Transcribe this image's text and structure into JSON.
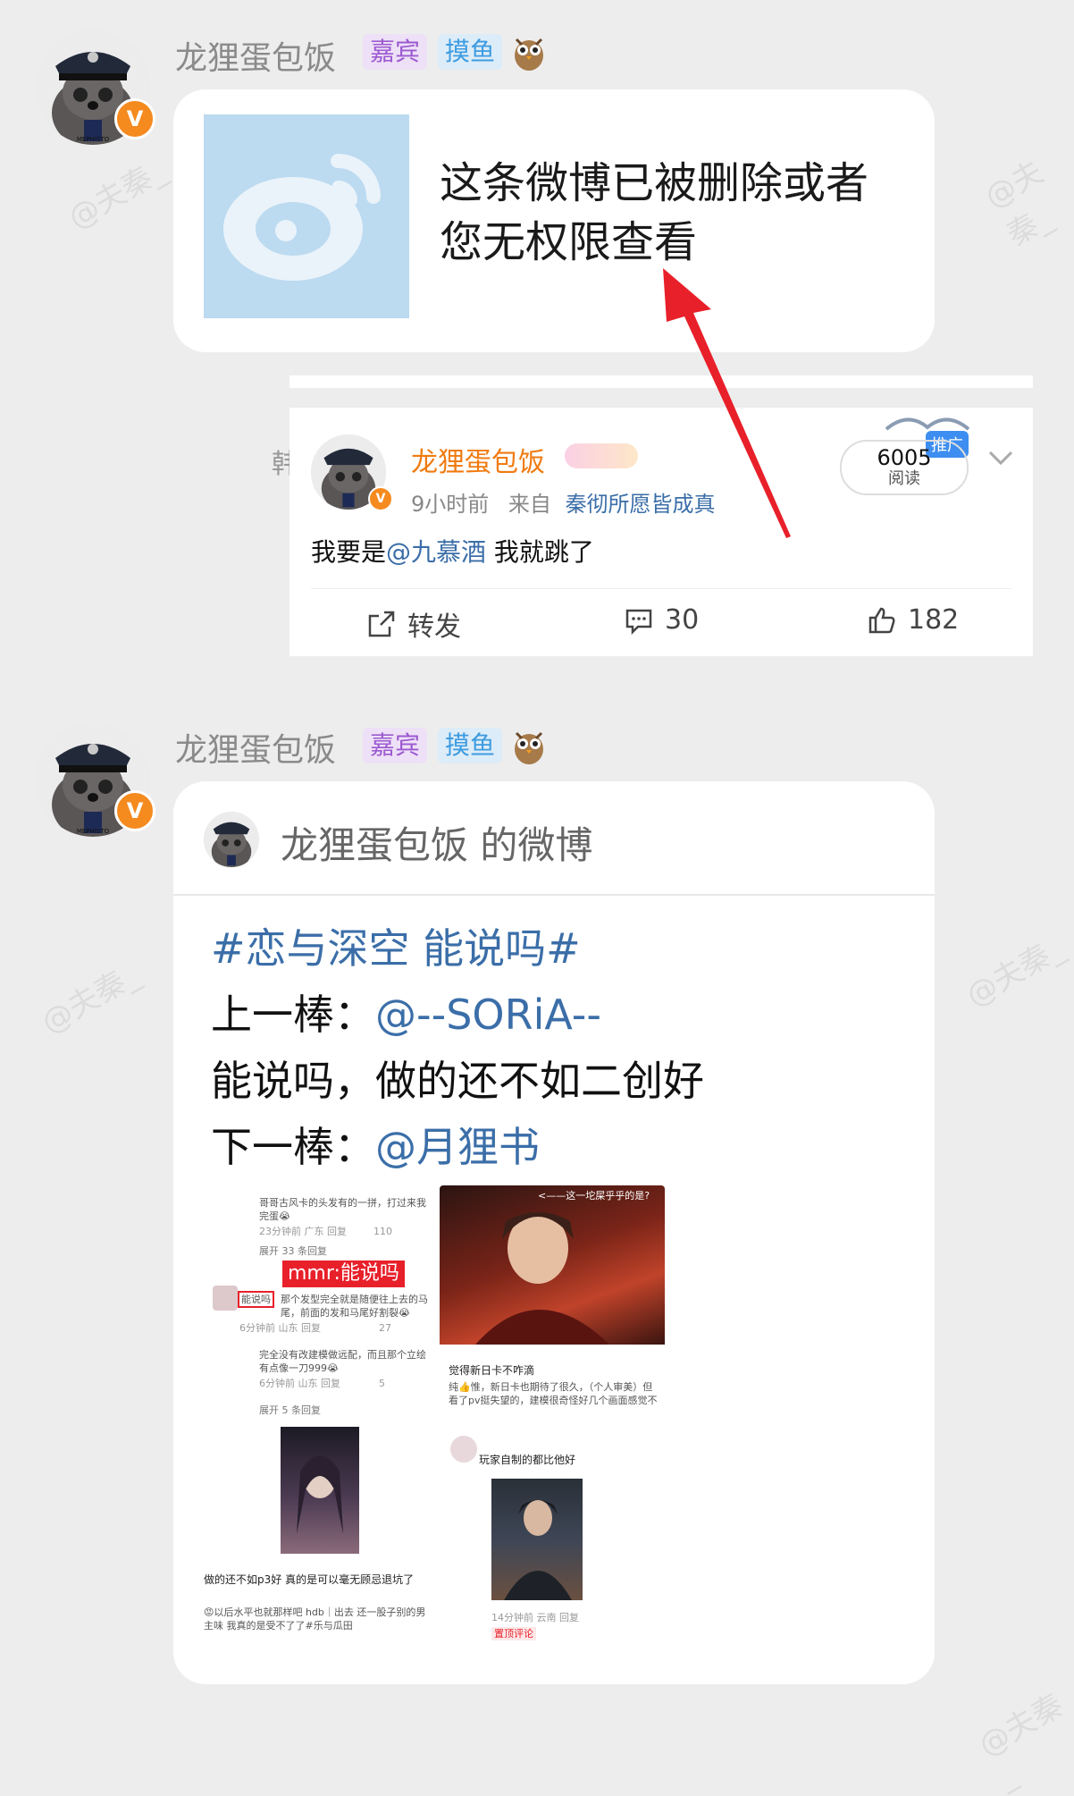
{
  "watermarks": [
    "@夫秦_",
    "@夫秦_",
    "@夫秦_",
    "@夫秦_",
    "@夫秦_"
  ],
  "msg1": {
    "username": "龙狸蛋包饭",
    "tag_guest": "嘉宾",
    "tag_fish": "摸鱼",
    "deleted_text_line1": "这条微博已被删除或者",
    "deleted_text_line2": "您无权限查看"
  },
  "embedded_post": {
    "side_char": "韩",
    "author": "龙狸蛋包饭",
    "time": "9小时前",
    "from_label": "来自",
    "source": "秦彻所愿皆成真",
    "promo_label": "推广",
    "reads_count": "6005",
    "reads_label": "阅读",
    "body_prefix": "我要是",
    "mention": "@九慕酒",
    "body_suffix": " 我就跳了",
    "repost_label": "转发",
    "comment_count": "30",
    "like_count": "182"
  },
  "msg2": {
    "username": "龙狸蛋包饭",
    "tag_guest": "嘉宾",
    "tag_fish": "摸鱼",
    "card_title": "龙狸蛋包饭 的微博",
    "hashtag": "#恋与深空 能说吗#",
    "line2_prefix": "上一棒：",
    "line2_mention": "@--SORiA--",
    "line3": "能说吗，做的还不如二创好",
    "line4_prefix": "下一棒：",
    "line4_mention": "@月狸书"
  },
  "collage": {
    "tl_comment1": "哥哥古风卡的头发有的一拼，打过来我完蛋😭",
    "tl_meta1": "23分钟前 广东  回复",
    "tl_likes1": "110",
    "tl_expand": "展开 33 条回复",
    "tl_highlight": "mmr:能说吗",
    "tl_boxed": "能说吗",
    "tl_comment2": "那个发型完全就是随便往上去的马尾，前面的发和马尾好割裂😭",
    "tl_meta2": "6分钟前 山东  回复",
    "tl_likes2": "27",
    "tl_comment3": "完全没有改建模做远配，而且那个立绘有点像一刀999😭",
    "tl_meta3": "6分钟前 山东  回复",
    "tl_likes3": "5",
    "tl_expand2": "展开 5 条回复",
    "tr_caption": "<——这一坨屎乎乎的是?",
    "tr_title": "觉得新日卡不咋滴",
    "tr_body": "纯👍惟，新日卡也期待了很久，（个人审美）但看了pv挺失望的，建模很奇怪好几个画面感觉不",
    "bl_text1": "做的还不如p3好 真的是可以毫无顾忌退坑了",
    "bl_text2": "😡以后水平也就那样吧 hdb｜出去 还一股子别的男主味 我真的是受不了了#乐与瓜田",
    "br_text": "玩家自制的都比他好",
    "br_meta": "14分钟前 云南  回复",
    "br_pinned": "置顶评论"
  },
  "colors": {
    "accent_orange": "#f58a1f",
    "link_blue": "#3b6ea8",
    "arrow_red": "#e8202a"
  }
}
